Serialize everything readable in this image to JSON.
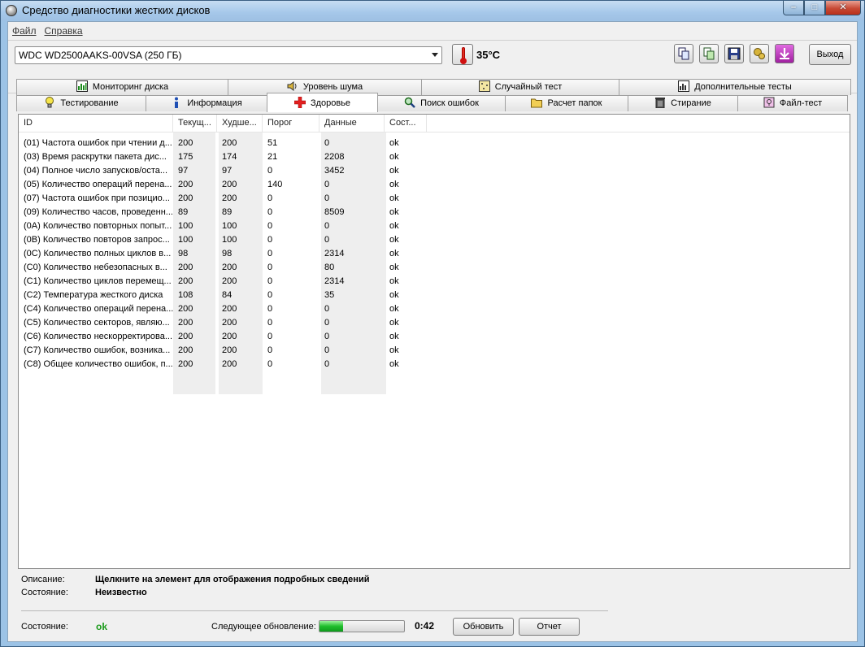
{
  "window": {
    "title": "Средство диагностики жестких дисков",
    "controls": {
      "minimize": "–",
      "maximize": "□",
      "close": "✕"
    }
  },
  "menu": {
    "file": "Файл",
    "help": "Справка"
  },
  "toolbar": {
    "disk": "WDC WD2500AAKS-00VSA     (250 ГБ)",
    "temperature": "35°C",
    "exit_label": "Выход",
    "icons": [
      "copy-icon",
      "copy-all-icon",
      "save-icon",
      "settings-icon",
      "download-icon"
    ]
  },
  "tabs_row1": [
    {
      "label": "Мониторинг диска",
      "icon": "chart-icon"
    },
    {
      "label": "Уровень шума",
      "icon": "speaker-icon"
    },
    {
      "label": "Случайный тест",
      "icon": "random-icon"
    },
    {
      "label": "Дополнительные тесты",
      "icon": "chart-icon"
    }
  ],
  "tabs_row2": [
    {
      "label": "Тестирование",
      "icon": "lightbulb-icon"
    },
    {
      "label": "Информация",
      "icon": "info-icon"
    },
    {
      "label": "Здоровье",
      "icon": "health-cross-icon",
      "active": true
    },
    {
      "label": "Поиск ошибок",
      "icon": "magnifier-icon"
    },
    {
      "label": "Расчет папок",
      "icon": "folder-icon"
    },
    {
      "label": "Стирание",
      "icon": "trash-icon"
    },
    {
      "label": "Файл-тест",
      "icon": "file-test-icon"
    }
  ],
  "table": {
    "headers": [
      "ID",
      "Текущ...",
      "Худше...",
      "Порог",
      "Данные",
      "Сост..."
    ],
    "rows": [
      [
        "(01) Частота ошибок при чтении д...",
        "200",
        "200",
        "51",
        "0",
        "ok"
      ],
      [
        "(03) Время раскрутки пакета дис...",
        "175",
        "174",
        "21",
        "2208",
        "ok"
      ],
      [
        "(04) Полное число запусков/оста...",
        "97",
        "97",
        "0",
        "3452",
        "ok"
      ],
      [
        "(05) Количество операций перена...",
        "200",
        "200",
        "140",
        "0",
        "ok"
      ],
      [
        "(07) Частота ошибок при позицио...",
        "200",
        "200",
        "0",
        "0",
        "ok"
      ],
      [
        "(09) Количество часов, проведенн...",
        "89",
        "89",
        "0",
        "8509",
        "ok"
      ],
      [
        "(0A) Количество повторных попыт...",
        "100",
        "100",
        "0",
        "0",
        "ok"
      ],
      [
        "(0B) Количество повторов запрос...",
        "100",
        "100",
        "0",
        "0",
        "ok"
      ],
      [
        "(0C) Количество полных циклов в...",
        "98",
        "98",
        "0",
        "2314",
        "ok"
      ],
      [
        "(C0) Количество небезопасных в...",
        "200",
        "200",
        "0",
        "80",
        "ok"
      ],
      [
        "(C1) Количество циклов перемещ...",
        "200",
        "200",
        "0",
        "2314",
        "ok"
      ],
      [
        "(C2) Температура жесткого диска",
        "108",
        "84",
        "0",
        "35",
        "ok"
      ],
      [
        "(C4) Количество операций перена...",
        "200",
        "200",
        "0",
        "0",
        "ok"
      ],
      [
        "(C5) Количество секторов, являю...",
        "200",
        "200",
        "0",
        "0",
        "ok"
      ],
      [
        "(C6) Количество нескорректирова...",
        "200",
        "200",
        "0",
        "0",
        "ok"
      ],
      [
        "(C7) Количество ошибок, возника...",
        "200",
        "200",
        "0",
        "0",
        "ok"
      ],
      [
        "(C8) Общее количество ошибок, п...",
        "200",
        "200",
        "0",
        "0",
        "ok"
      ]
    ]
  },
  "details": {
    "description_label": "Описание:",
    "description_value": "Щелкните на элемент для отображения подробных сведений",
    "state_label": "Состояние:",
    "state_value": "Неизвестно"
  },
  "footer": {
    "status_label": "Состояние:",
    "status_value": "ok",
    "next_update_label": "Следующее обновление:",
    "progress_fraction": 0.28,
    "time": "0:42",
    "refresh_label": "Обновить",
    "report_label": "Отчет"
  },
  "colors": {
    "ok_green": "#1a9a1a",
    "titlebar": "#a6c8ea"
  }
}
